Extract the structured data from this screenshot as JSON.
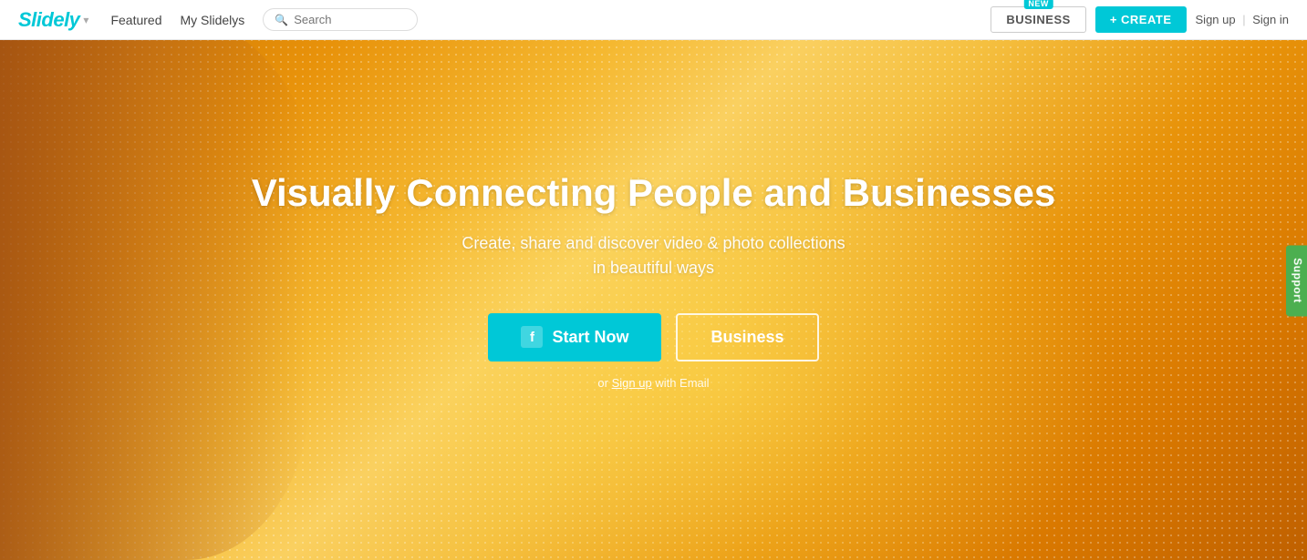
{
  "navbar": {
    "logo": "Slidely",
    "dropdown_icon": "▾",
    "nav_links": [
      {
        "id": "featured",
        "label": "Featured"
      },
      {
        "id": "my-slidelys",
        "label": "My Slidelys"
      }
    ],
    "search_placeholder": "Search",
    "business_label": "BUSINESS",
    "new_badge": "NEW",
    "create_label": "+ CREATE",
    "sign_up": "Sign up",
    "sign_in": "Sign in",
    "auth_separator": "|"
  },
  "hero": {
    "title": "Visually Connecting People and Businesses",
    "subtitle_line1": "Create, share and discover video & photo collections",
    "subtitle_line2": "in beautiful ways",
    "start_now_label": "Start Now",
    "business_label": "Business",
    "or_text": "or",
    "sign_up_link": "Sign up",
    "with_email": "with Email",
    "facebook_icon": "f"
  },
  "support": {
    "label": "Support"
  },
  "colors": {
    "primary": "#00c8d7",
    "support_green": "#4caf50"
  }
}
